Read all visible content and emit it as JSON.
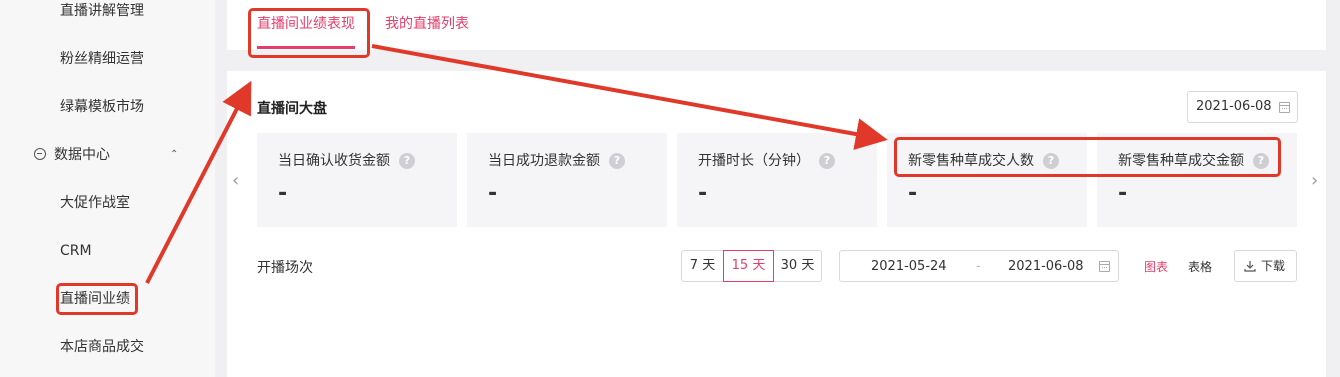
{
  "sidebar": {
    "items_above": [
      "直播讲解管理",
      "粉丝精细运营",
      "绿幕模板市场"
    ],
    "group": {
      "label": "数据中心",
      "icon": "minus-circle-icon",
      "chevron": "chevron-up-icon"
    },
    "items_below": [
      "大促作战室",
      "CRM",
      "直播间业绩",
      "本店商品成交"
    ]
  },
  "tabs": [
    {
      "label": "直播间业绩表现",
      "active": true
    },
    {
      "label": "我的直播列表",
      "active": false
    }
  ],
  "dashboard": {
    "title": "直播间大盘",
    "date": "2021-06-08",
    "metrics": [
      {
        "label": "当日确认收货金额",
        "value": "-"
      },
      {
        "label": "当日成功退款金额",
        "value": "-"
      },
      {
        "label": "开播时长（分钟）",
        "value": "-"
      },
      {
        "label": "新零售种草成交人数",
        "value": "-"
      },
      {
        "label": "新零售种草成交金额",
        "value": "-"
      }
    ],
    "help_glyph": "?",
    "prev_glyph": "‹",
    "next_glyph": "›"
  },
  "sessions": {
    "label": "开播场次",
    "ranges": [
      {
        "label": "7 天",
        "active": false
      },
      {
        "label": "15 天",
        "active": true
      },
      {
        "label": "30 天",
        "active": false
      }
    ],
    "start_date": "2021-05-24",
    "separator": "-",
    "end_date": "2021-06-08",
    "view_chart": "图表",
    "view_table": "表格",
    "download": "下载"
  },
  "colors": {
    "accent": "#e53e6b",
    "annotation": "#e0392a"
  }
}
